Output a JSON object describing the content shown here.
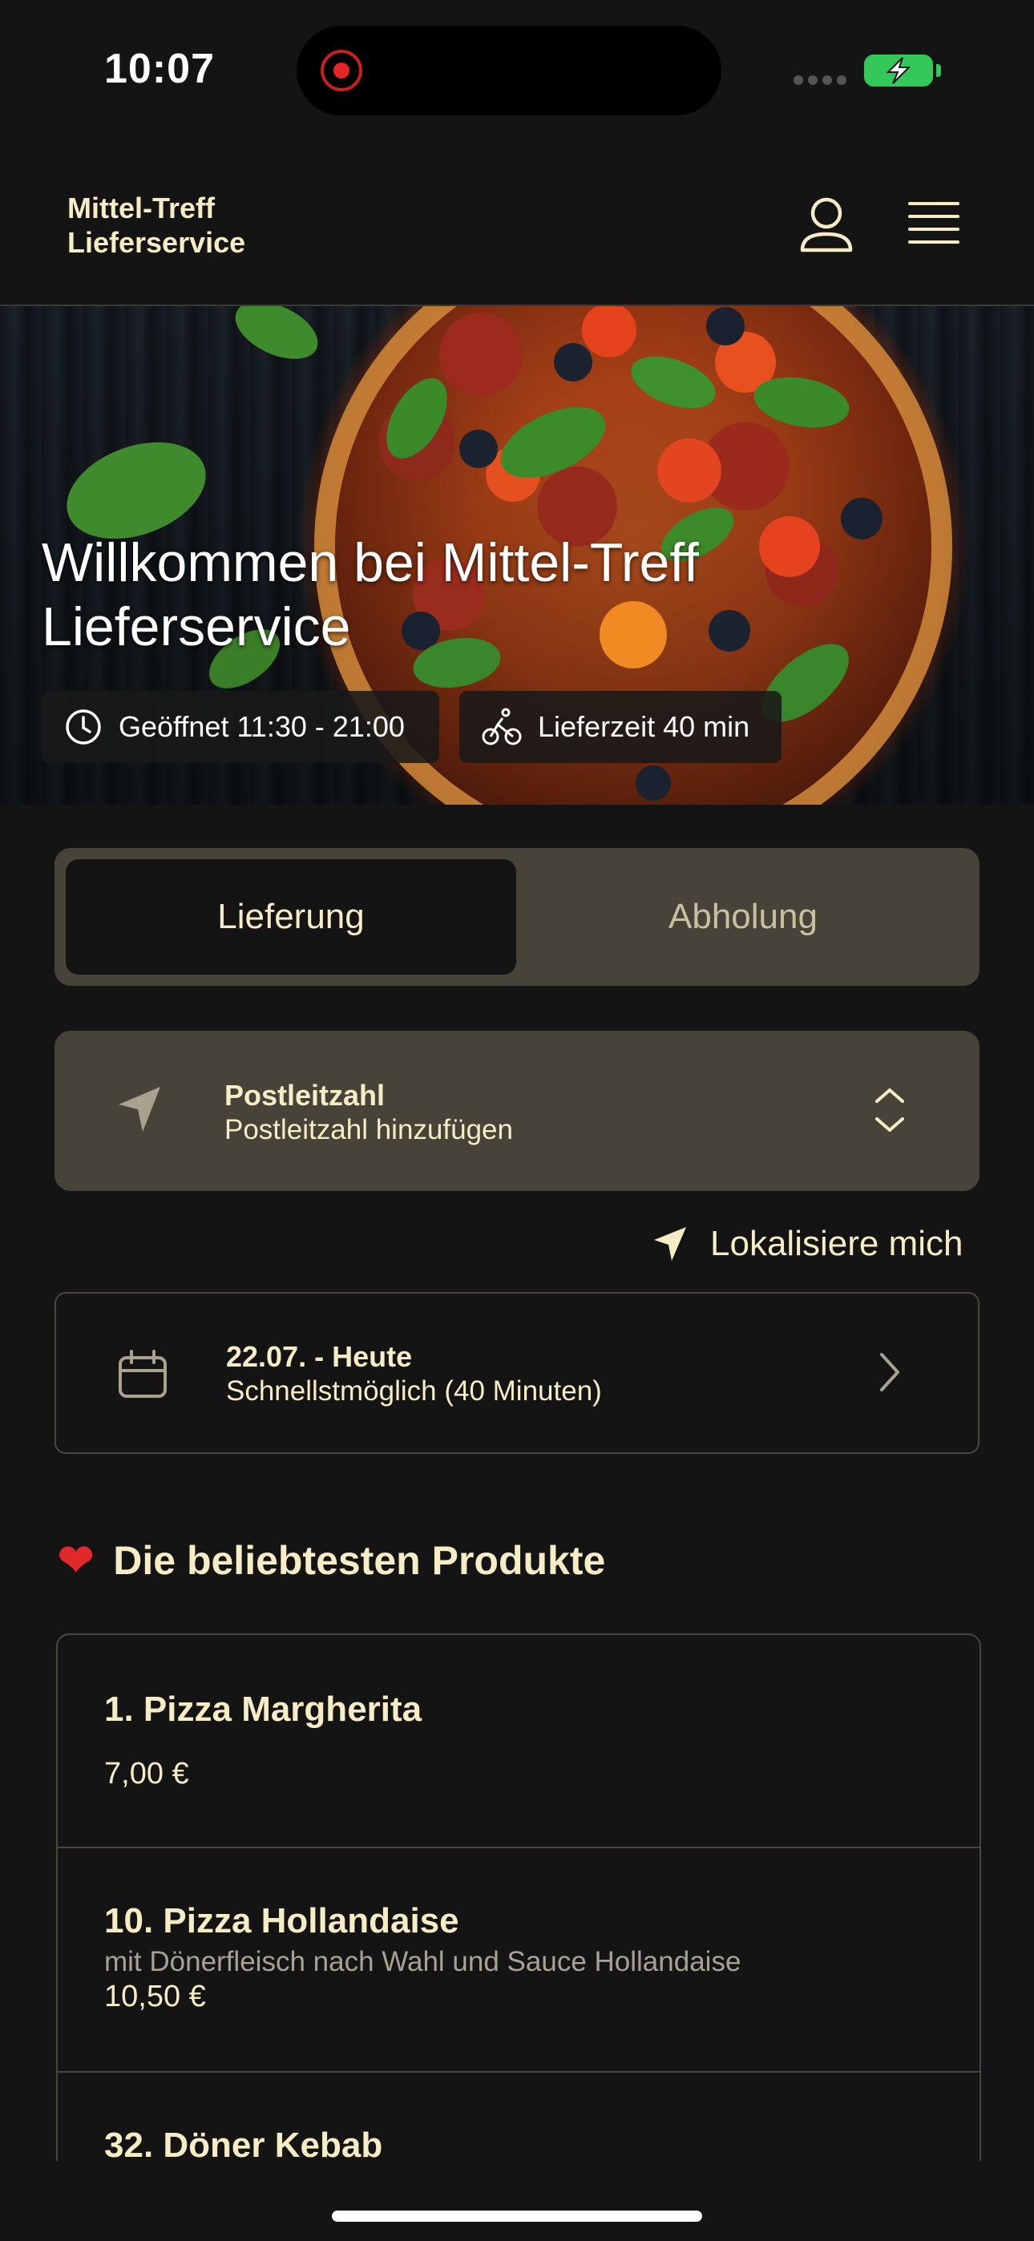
{
  "status_bar": {
    "time": "10:07"
  },
  "header": {
    "brand_line1": "Mittel-Treff",
    "brand_line2": "Lieferservice",
    "icons": [
      "user-icon",
      "menu-icon"
    ]
  },
  "hero": {
    "title_line1": "Willkommen bei Mittel-Treff",
    "title_line2": "Lieferservice",
    "opening_hours": "Geöffnet 11:30 - 21:00",
    "delivery_time": "Lieferzeit 40 min"
  },
  "order_mode": {
    "tabs": [
      "Lieferung",
      "Abholung"
    ],
    "selected": "Lieferung"
  },
  "postal": {
    "label": "Postleitzahl",
    "placeholder": "Postleitzahl hinzufügen"
  },
  "locate_label": "Lokalisiere mich",
  "schedule": {
    "date": "22.07. - Heute",
    "time": "Schnellstmöglich (40 Minuten)"
  },
  "popular": {
    "title": "Die beliebtesten Produkte",
    "items": [
      {
        "name": "1. Pizza Margherita",
        "description": "",
        "price": "7,00 €"
      },
      {
        "name": "10. Pizza Hollandaise",
        "description": "mit Dönerfleisch nach Wahl und Sauce Hollandaise",
        "price": "10,50 €"
      },
      {
        "name": "32. Döner Kebab",
        "description": "",
        "price": ""
      }
    ]
  },
  "colors": {
    "background": "#141414",
    "accent_text": "#f6ecc6",
    "card": "#474339",
    "battery": "#34c759",
    "heart": "#e0282d"
  }
}
